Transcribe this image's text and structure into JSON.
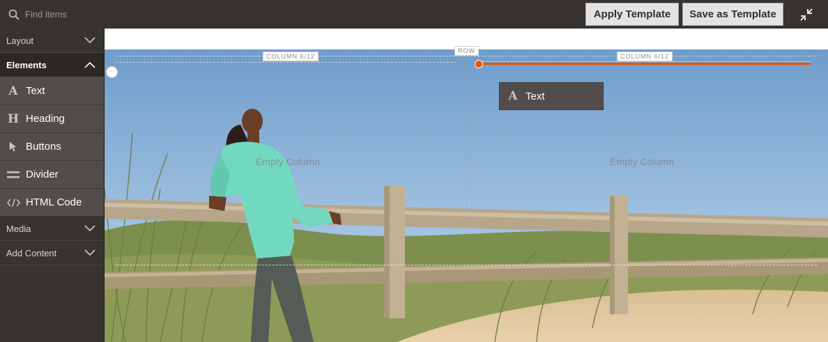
{
  "search": {
    "placeholder": "Find items"
  },
  "toolbar": {
    "apply_label": "Apply Template",
    "save_label": "Save as Template"
  },
  "sidebar": {
    "sections": [
      {
        "label": "Layout",
        "state": "collapsed"
      },
      {
        "label": "Elements",
        "state": "expanded"
      },
      {
        "label": "Media",
        "state": "collapsed"
      },
      {
        "label": "Add Content",
        "state": "collapsed"
      }
    ],
    "elements": [
      {
        "label": "Text",
        "icon": "text-icon"
      },
      {
        "label": "Heading",
        "icon": "heading-icon"
      },
      {
        "label": "Buttons",
        "icon": "cursor-icon"
      },
      {
        "label": "Divider",
        "icon": "divider-icon"
      },
      {
        "label": "HTML Code",
        "icon": "code-icon"
      }
    ]
  },
  "stage": {
    "row_label": "ROW",
    "columns": [
      {
        "label": "COLUMN 6/12",
        "empty_text": "Empty Column"
      },
      {
        "label": "COLUMN 6/12",
        "empty_text": "Empty Column"
      }
    ],
    "drag_item": {
      "label": "Text",
      "icon": "text-icon"
    }
  },
  "colors": {
    "accent": "#eb5202",
    "panel": "#373330",
    "item": "#524d4a"
  }
}
